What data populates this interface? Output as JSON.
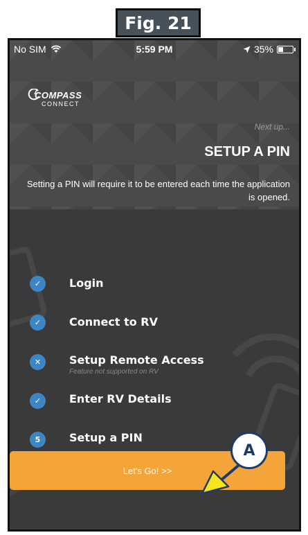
{
  "figure": {
    "label": "Fig. 21"
  },
  "status_bar": {
    "carrier": "No SIM",
    "time": "5:59 PM",
    "battery_percent_text": "35%",
    "battery_level": 0.35
  },
  "logo": {
    "line1": "COMPASS",
    "line2": "CONNECT"
  },
  "hero": {
    "next_up": "Next up...",
    "title": "SETUP A PIN",
    "description": "Setting a PIN will require it to be entered each time the application is opened."
  },
  "steps": [
    {
      "label": "Login",
      "marker": "✓",
      "status": "done",
      "note": ""
    },
    {
      "label": "Connect to RV",
      "marker": "✓",
      "status": "done",
      "note": ""
    },
    {
      "label": "Setup Remote Access",
      "marker": "✕",
      "status": "skipped",
      "note": "Feature not supported on RV"
    },
    {
      "label": "Enter RV Details",
      "marker": "✓",
      "status": "done",
      "note": ""
    },
    {
      "label": "Setup a PIN",
      "marker": "5",
      "status": "current",
      "note": ""
    }
  ],
  "go_button": {
    "label": "Let's Go! >>"
  },
  "callout": {
    "label": "A"
  },
  "colors": {
    "accent_blue": "#3d86c6",
    "button_orange": "#f4a53a",
    "callout_navy": "#1e3a6b",
    "arrow_yellow": "#f5e51c"
  }
}
